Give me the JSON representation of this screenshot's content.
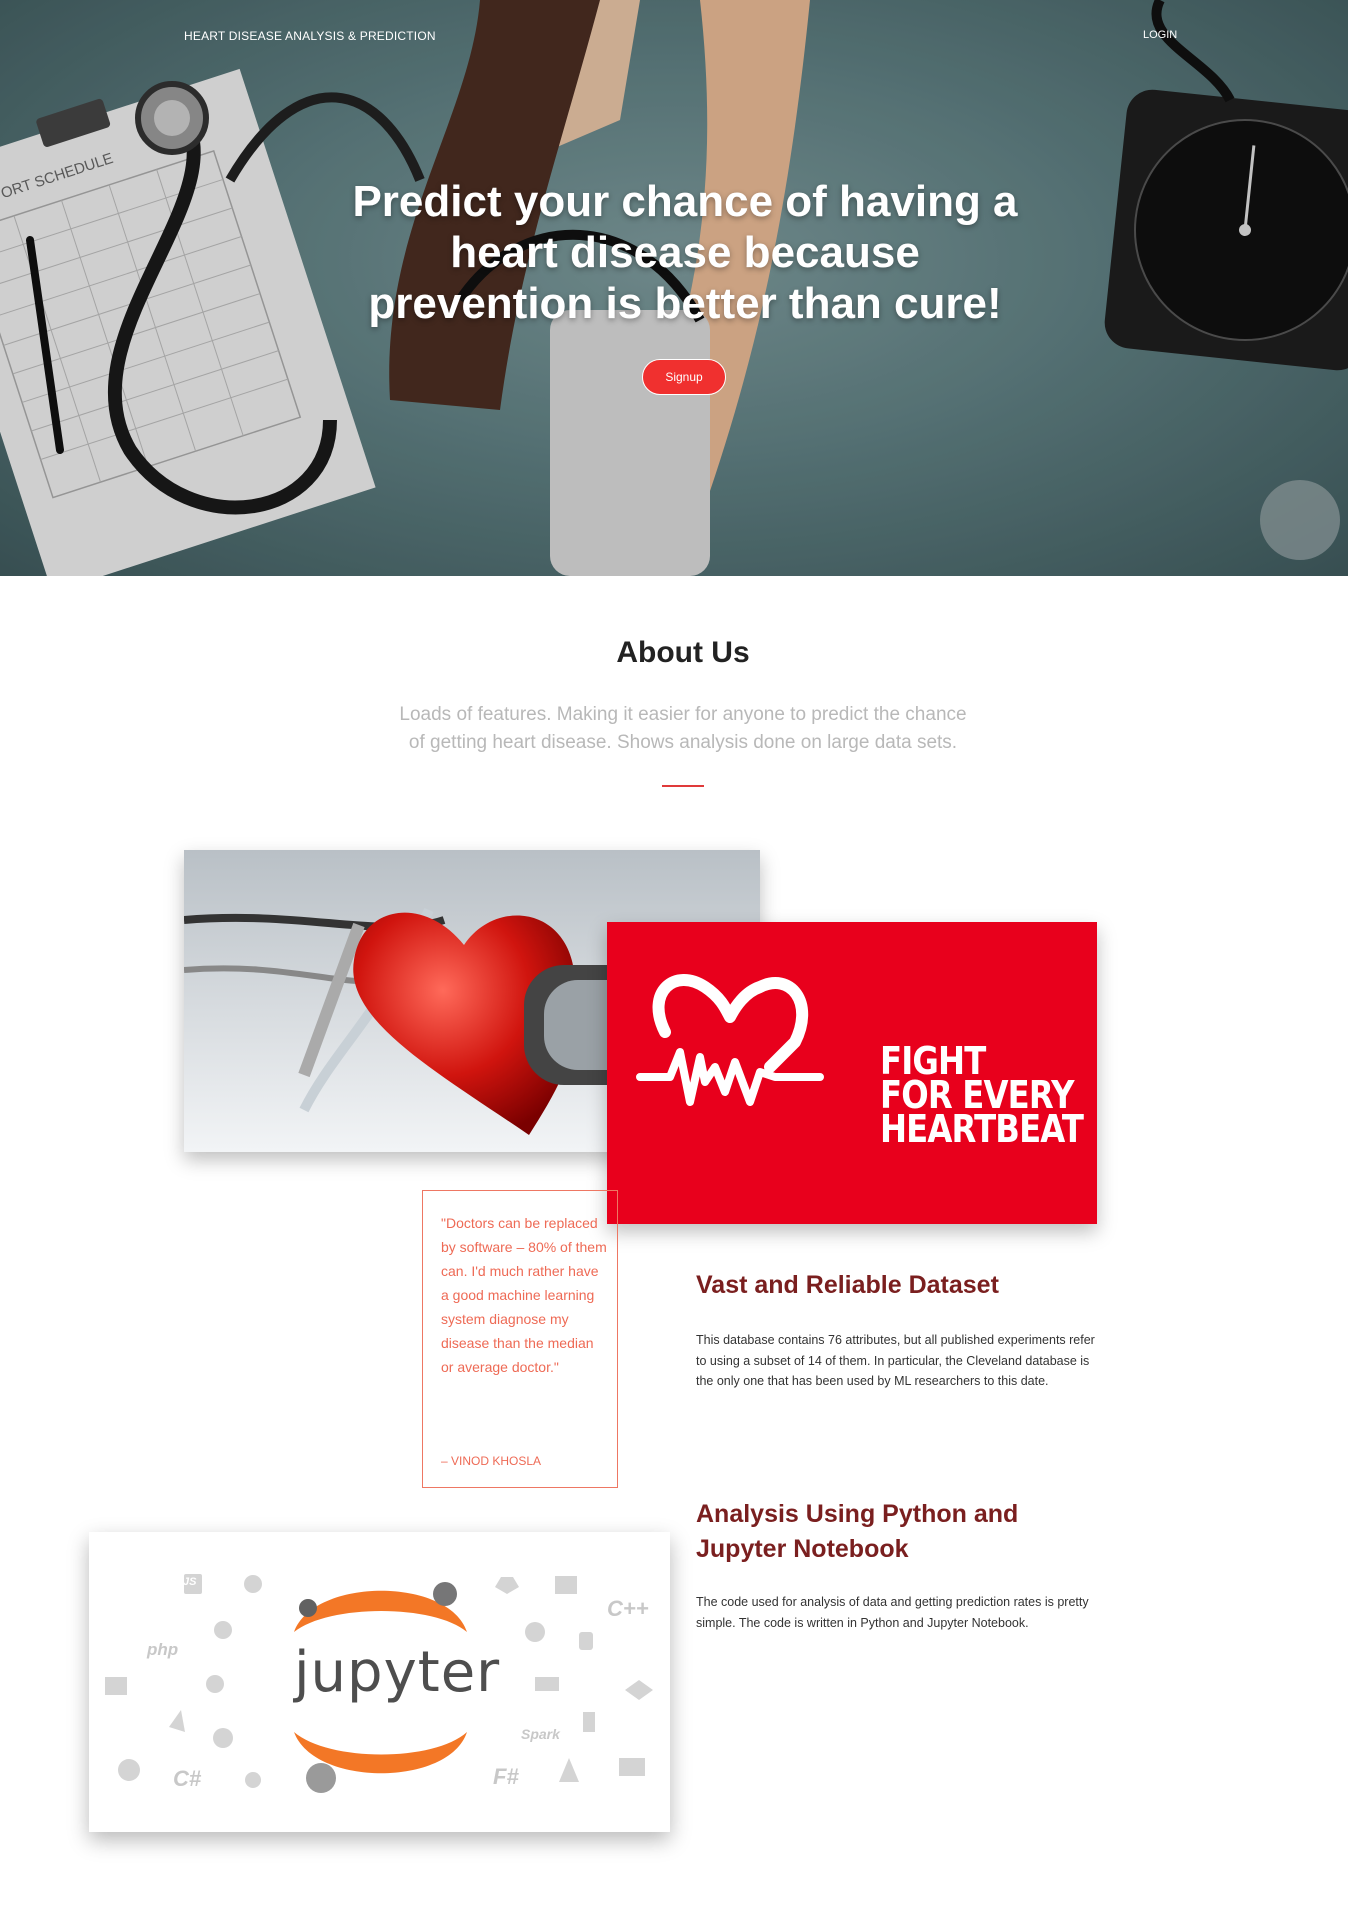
{
  "nav": {
    "brand": "HEART DISEASE ANALYSIS & PREDICTION",
    "login": "LOGIN"
  },
  "hero": {
    "title_line1": "Predict your chance of having a",
    "title_line2": "heart disease because",
    "title_line3": "prevention is better than cure!",
    "signup_label": "Signup"
  },
  "about": {
    "title": "About Us",
    "subtitle_line1": "Loads of features. Making it easier for anyone to predict the chance",
    "subtitle_line2": "of getting heart disease. Shows analysis done on large data sets."
  },
  "fight_card": {
    "line1": "FIGHT",
    "line2": "FOR EVERY",
    "line3": "HEARTBEAT"
  },
  "quote": {
    "text": "\"Doctors can be replaced by software – 80% of them can. I'd much rather have a good machine learning system diagnose my disease than the median or average doctor.\"",
    "author": "– VINOD KHOSLA"
  },
  "features": [
    {
      "title": "Vast and Reliable Dataset",
      "text": "This database contains 76 attributes, but all published experiments refer to using a subset of 14 of them. In particular, the Cleveland database is the only one that has been used by ML researchers to this date."
    },
    {
      "title_line1": "Analysis Using Python and",
      "title_line2": "Jupyter Notebook",
      "text": "The code used for analysis of data and getting prediction rates is pretty simple. The code is written in Python and Jupyter Notebook."
    }
  ],
  "jupyter_card": {
    "word": "jupyter",
    "languages": [
      "php",
      "C#",
      "F#",
      "C++",
      "Spark",
      "JS"
    ]
  },
  "colors": {
    "accent": "#f0302f",
    "brand_red": "#e8001c",
    "quote": "#ee6a55",
    "feature_title": "#7a1f1f",
    "jupyter_orange": "#f37726"
  }
}
